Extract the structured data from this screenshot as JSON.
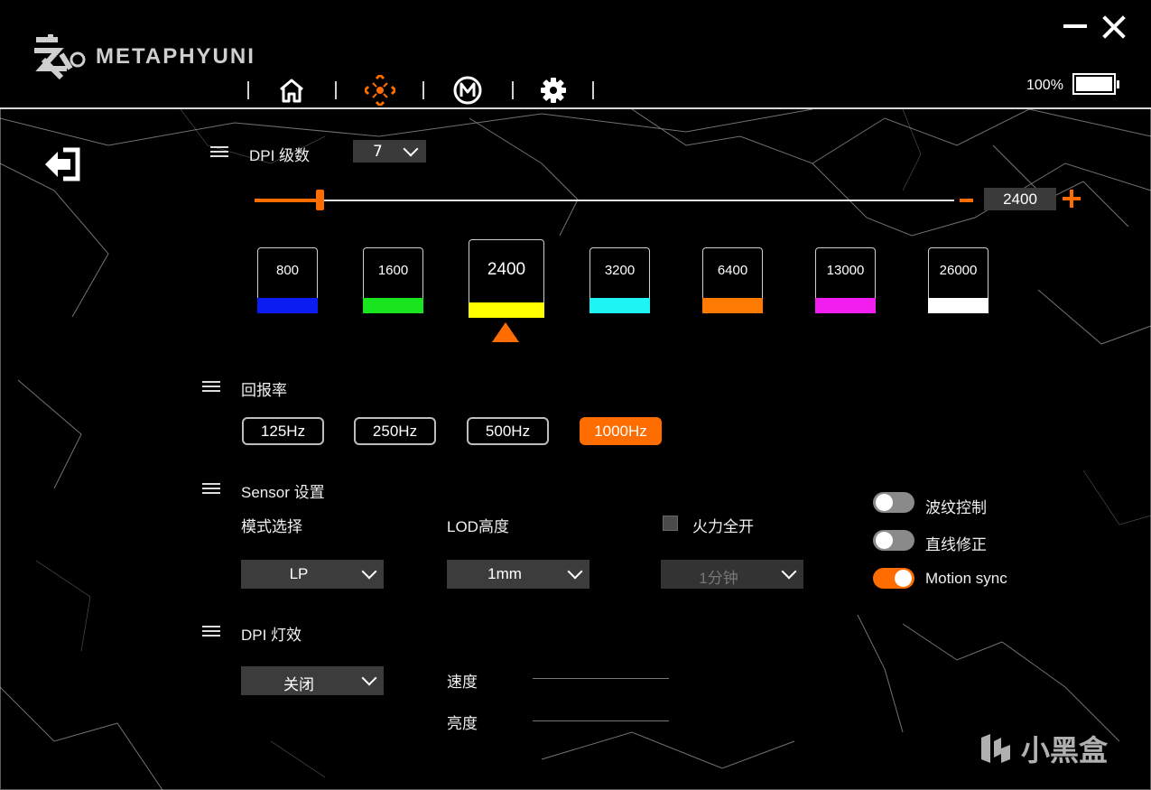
{
  "app": {
    "brand": "METAPHYUNI"
  },
  "nav": {
    "items": [
      {
        "name": "home",
        "icon": "home-icon"
      },
      {
        "name": "performance",
        "icon": "crosshair-icon"
      },
      {
        "name": "macro",
        "icon": "macro-m-icon"
      },
      {
        "name": "settings",
        "icon": "gear-icon"
      }
    ],
    "active": "performance"
  },
  "battery": {
    "label": "100%",
    "level": 1.0
  },
  "dpi": {
    "title": "DPI 级数",
    "levels_count": "7",
    "current_value": "2400",
    "slider_min": 50,
    "slider_max": 26000,
    "slider_fraction": 0.093,
    "selected_index": 2,
    "stages": [
      {
        "value": "800",
        "color": "#0b1cf2"
      },
      {
        "value": "1600",
        "color": "#18e41f"
      },
      {
        "value": "2400",
        "color": "#ffff00"
      },
      {
        "value": "3200",
        "color": "#1ef4f4"
      },
      {
        "value": "6400",
        "color": "#ff7a00"
      },
      {
        "value": "13000",
        "color": "#f21ef0"
      },
      {
        "value": "26000",
        "color": "#ffffff"
      }
    ]
  },
  "polling": {
    "title": "回报率",
    "options": [
      "125Hz",
      "250Hz",
      "500Hz",
      "1000Hz"
    ],
    "selected": "1000Hz"
  },
  "sensor": {
    "title": "Sensor 设置",
    "mode_label": "模式选择",
    "mode_value": "LP",
    "lod_label": "LOD高度",
    "lod_value": "1mm",
    "fire_label": "火力全开",
    "fire_checked": false,
    "fire_value": "1分钟",
    "toggles": [
      {
        "label": "波纹控制",
        "on": false
      },
      {
        "label": "直线修正",
        "on": false
      },
      {
        "label": "Motion sync",
        "on": true
      }
    ]
  },
  "dpi_light": {
    "title": "DPI 灯效",
    "mode_value": "关闭",
    "speed_label": "速度",
    "brightness_label": "亮度"
  },
  "watermark": {
    "text": "小黑盒"
  },
  "colors": {
    "accent": "#ff6d00",
    "panel": "#3a3a3a"
  }
}
